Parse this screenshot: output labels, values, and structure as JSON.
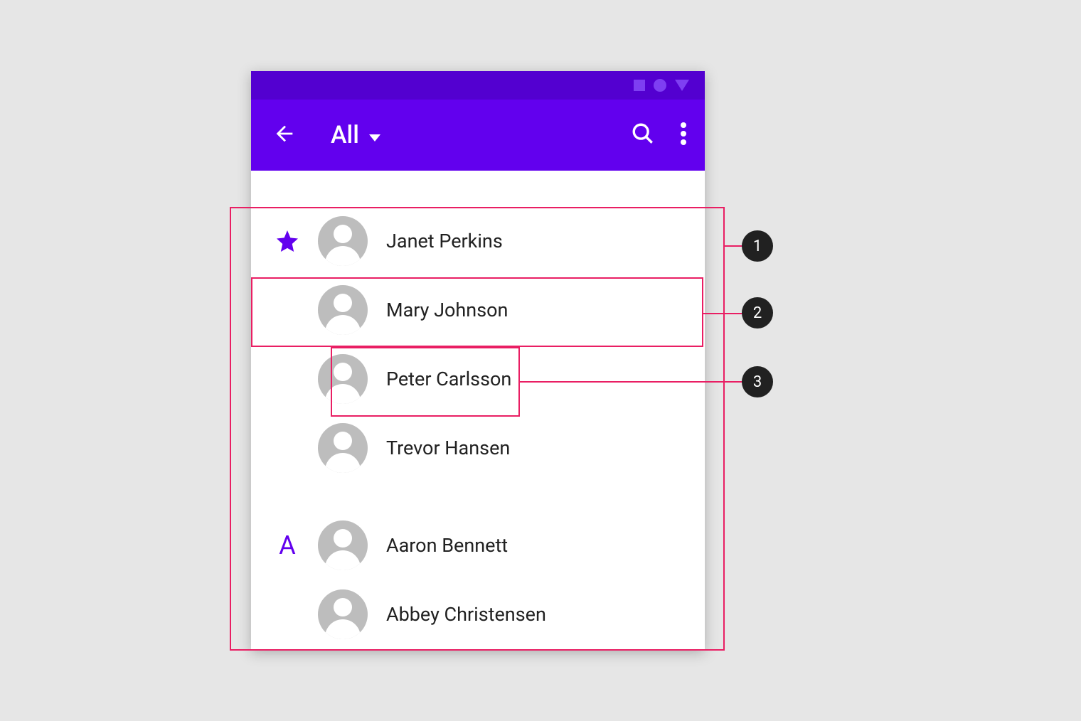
{
  "colors": {
    "primary": "#6200EE",
    "primaryDark": "#5300D0",
    "annotation": "#E91E63"
  },
  "appbar": {
    "title": "All"
  },
  "sections": [
    {
      "marker": "star",
      "items": [
        {
          "name": "Janet Perkins"
        },
        {
          "name": "Mary Johnson"
        },
        {
          "name": "Peter Carlsson"
        },
        {
          "name": "Trevor Hansen"
        }
      ]
    },
    {
      "marker": "A",
      "items": [
        {
          "name": "Aaron Bennett"
        },
        {
          "name": "Abbey Christensen"
        }
      ]
    }
  ],
  "annotations": {
    "1": "1",
    "2": "2",
    "3": "3"
  }
}
